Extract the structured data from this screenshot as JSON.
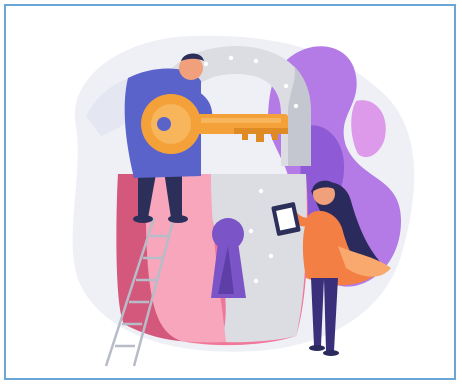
{
  "illustration": {
    "icon": "unlocked-padlock-with-key-icon",
    "colors": {
      "frame_border": "#6aa6d8",
      "background_blob": "#eef0f6",
      "plant_purple": "#b47ae6",
      "plant_violet": "#8f5ad6",
      "shackle": "#dcdde3",
      "padlock_pink": "#f0779a",
      "padlock_dark_pink": "#d4587c",
      "padlock_light": "#f7a6bb",
      "key_orange": "#f5a13a",
      "keyhole_purple": "#7b55c7",
      "person_jacket_blue": "#5a63c9",
      "person_pants_navy": "#2c2f5a",
      "woman_shirt_orange": "#f37f45",
      "woman_hair": "#2b2a5c",
      "woman_pants": "#3a2f7a",
      "ladder": "#b8bcc8",
      "skin": "#f0a07a"
    }
  }
}
